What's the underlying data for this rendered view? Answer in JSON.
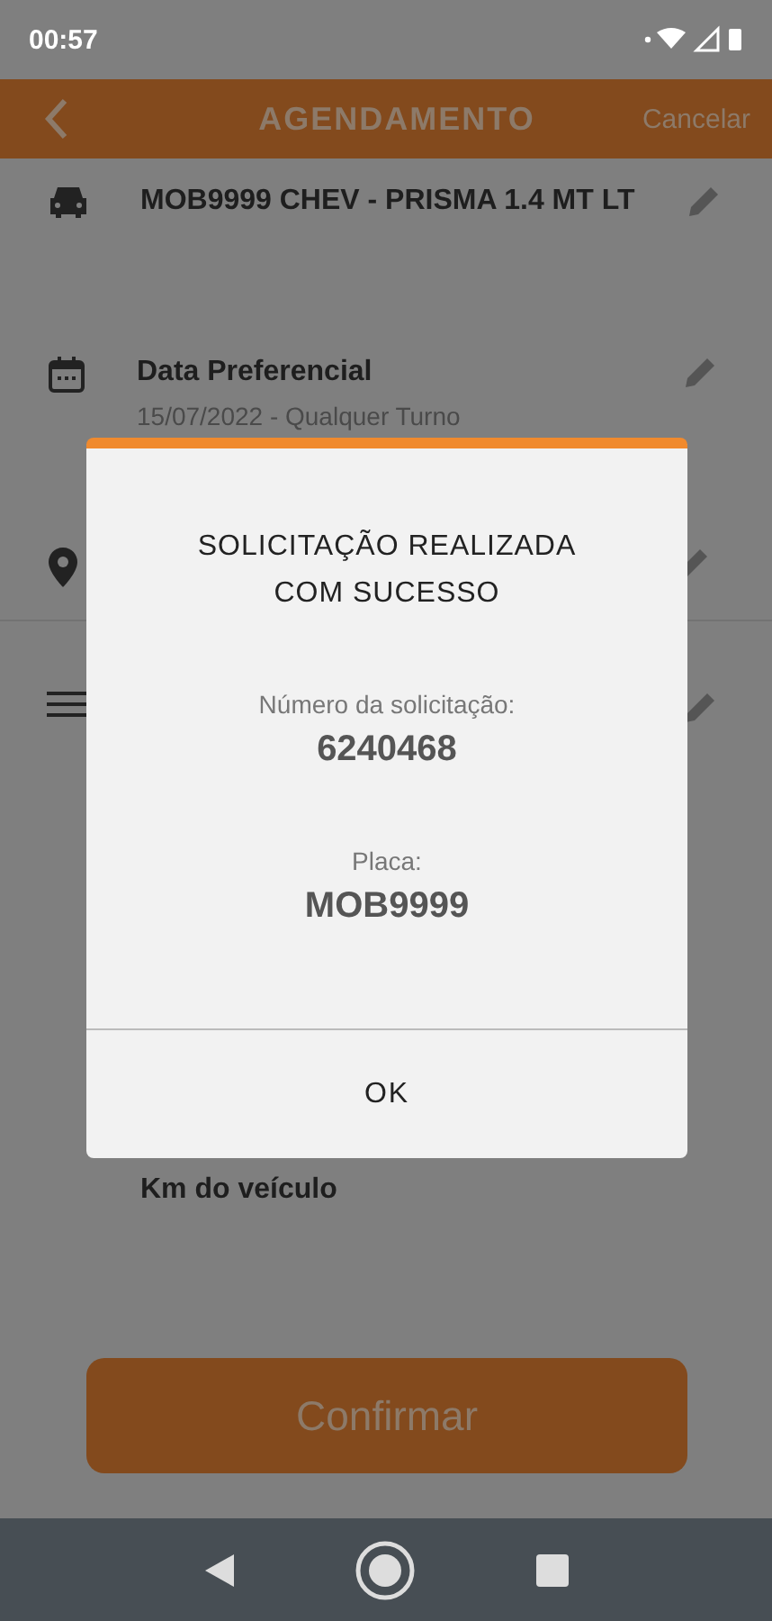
{
  "status_bar": {
    "time": "00:57"
  },
  "header": {
    "title": "AGENDAMENTO",
    "action": "Cancelar"
  },
  "items": [
    {
      "kind": "vehicle",
      "title": "MOB9999 CHEV - PRISMA 1.4 MT LT"
    },
    {
      "kind": "date",
      "title": "Data Preferencial",
      "subtitle": "15/07/2022 - Qualquer Turno"
    },
    {
      "kind": "location"
    },
    {
      "kind": "description"
    }
  ],
  "km_label": "Km do veículo",
  "confirm_button": "Confirmar",
  "dialog": {
    "title": "SOLICITAÇÃO REALIZADA COM SUCESSO",
    "fields": [
      {
        "label": "Número da solicitação:",
        "value": "6240468"
      },
      {
        "label": "Placa:",
        "value": "MOB9999"
      }
    ],
    "button": "OK"
  }
}
